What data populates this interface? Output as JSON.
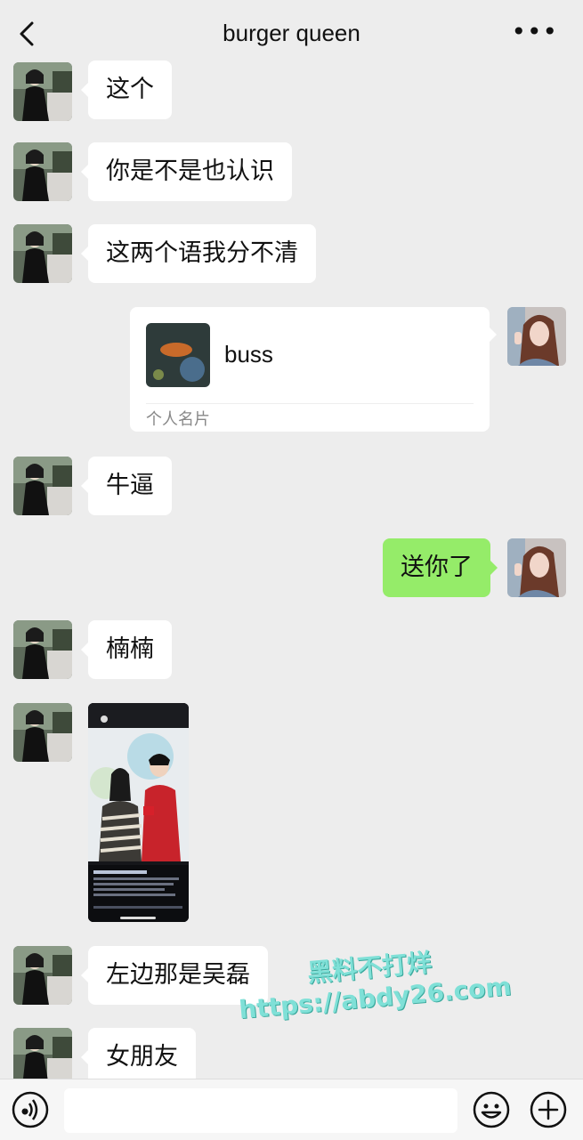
{
  "header": {
    "title": "burger queen",
    "more_label": "•••"
  },
  "messages": [
    {
      "text": "这个"
    },
    {
      "text": "你是不是也认识"
    },
    {
      "text": "这两个语我分不清"
    },
    {
      "card_name": "buss",
      "card_type": "个人名片"
    },
    {
      "text": "牛逼"
    },
    {
      "text": "送你了"
    },
    {
      "text": "楠楠"
    },
    {
      "image": "phone-screenshot"
    },
    {
      "text": "左边那是吴磊"
    },
    {
      "text": "女朋友"
    }
  ],
  "watermark": {
    "line1": "黑料不打烊",
    "line2": "https://abdy26.com"
  },
  "icons": [
    "back-arrow-icon",
    "more-icon",
    "voice-icon",
    "emoji-icon",
    "plus-icon"
  ],
  "colors": {
    "background": "#ededed",
    "outgoing_bubble": "#95ec69",
    "incoming_bubble": "#ffffff"
  }
}
